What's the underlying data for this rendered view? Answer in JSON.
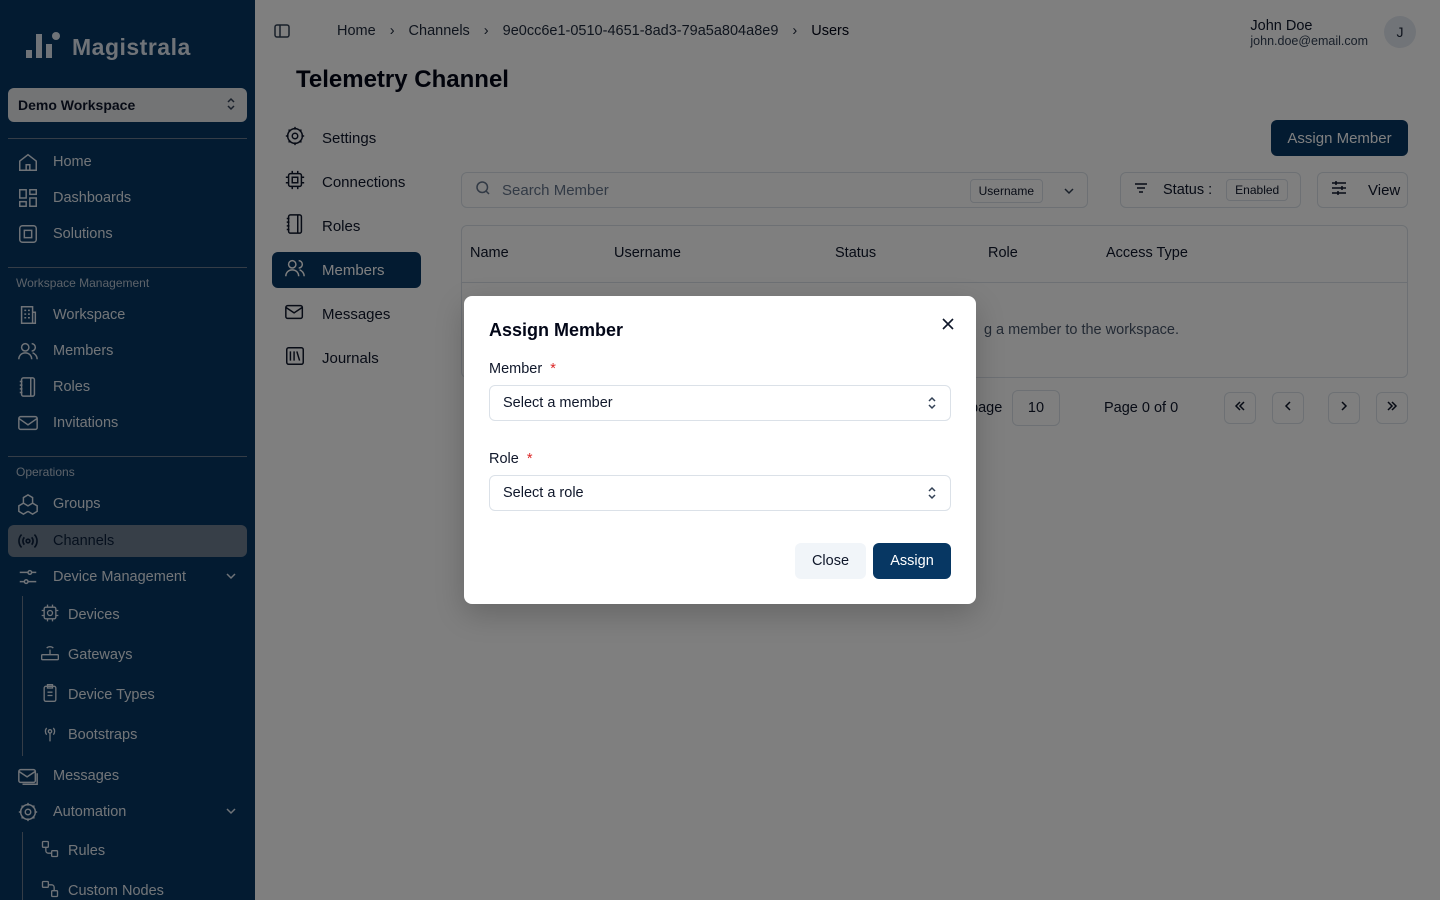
{
  "app": {
    "name": "Magistrala"
  },
  "sidebar": {
    "workspace": "Demo Workspace",
    "items_top": [
      {
        "label": "Home",
        "icon": "home-icon"
      },
      {
        "label": "Dashboards",
        "icon": "dashboard-icon"
      },
      {
        "label": "Solutions",
        "icon": "solutions-icon"
      }
    ],
    "section_workspace": "Workspace Management",
    "items_workspace": [
      {
        "label": "Workspace",
        "icon": "building-icon"
      },
      {
        "label": "Members",
        "icon": "users-icon"
      },
      {
        "label": "Roles",
        "icon": "notebook-icon"
      },
      {
        "label": "Invitations",
        "icon": "mail-icon"
      }
    ],
    "section_operations": "Operations",
    "items_operations": [
      {
        "label": "Groups",
        "icon": "groups-icon"
      },
      {
        "label": "Channels",
        "icon": "radio-icon",
        "active": true
      },
      {
        "label": "Device Management",
        "icon": "sliders-icon"
      }
    ],
    "device_sub": [
      {
        "label": "Devices",
        "icon": "chip-icon"
      },
      {
        "label": "Gateways",
        "icon": "router-icon"
      },
      {
        "label": "Device Types",
        "icon": "clipboard-icon"
      },
      {
        "label": "Bootstraps",
        "icon": "signal-icon"
      }
    ],
    "items_more": [
      {
        "label": "Messages",
        "icon": "mail-open-icon"
      },
      {
        "label": "Automation",
        "icon": "cog-icon"
      }
    ],
    "automation_sub": [
      {
        "label": "Rules",
        "icon": "workflow-icon"
      },
      {
        "label": "Custom Nodes",
        "icon": "nodes-icon"
      }
    ]
  },
  "header": {
    "breadcrumb": [
      "Home",
      "Channels",
      "9e0cc6e1-0510-4651-8ad3-79a5a804a8e9",
      "Users"
    ],
    "user_name": "John Doe",
    "user_email": "john.doe@email.com",
    "avatar_initial": "J"
  },
  "page": {
    "title": "Telemetry Channel",
    "subnav": [
      {
        "label": "Settings",
        "icon": "settings-icon"
      },
      {
        "label": "Connections",
        "icon": "cpu-icon"
      },
      {
        "label": "Roles",
        "icon": "notebook-icon"
      },
      {
        "label": "Members",
        "icon": "users-icon",
        "active": true
      },
      {
        "label": "Messages",
        "icon": "mail-open-icon"
      },
      {
        "label": "Journals",
        "icon": "library-icon"
      }
    ],
    "assign_button": "Assign Member",
    "search_placeholder": "Search Member",
    "search_field": "Username",
    "status_label": "Status :",
    "status_value": "Enabled",
    "view_label": "View",
    "columns": [
      "Name",
      "Username",
      "Status",
      "Role",
      "Access Type"
    ],
    "empty_message": "g a member to the workspace.",
    "pager_label": "page",
    "page_size": "10",
    "page_info": "Page 0 of 0"
  },
  "modal": {
    "title": "Assign Member",
    "member_label": "Member",
    "member_placeholder": "Select a member",
    "role_label": "Role",
    "role_placeholder": "Select a role",
    "required_mark": "*",
    "close_button": "Close",
    "assign_button": "Assign"
  },
  "colors": {
    "primary": "#073763",
    "required": "#dc2626"
  }
}
